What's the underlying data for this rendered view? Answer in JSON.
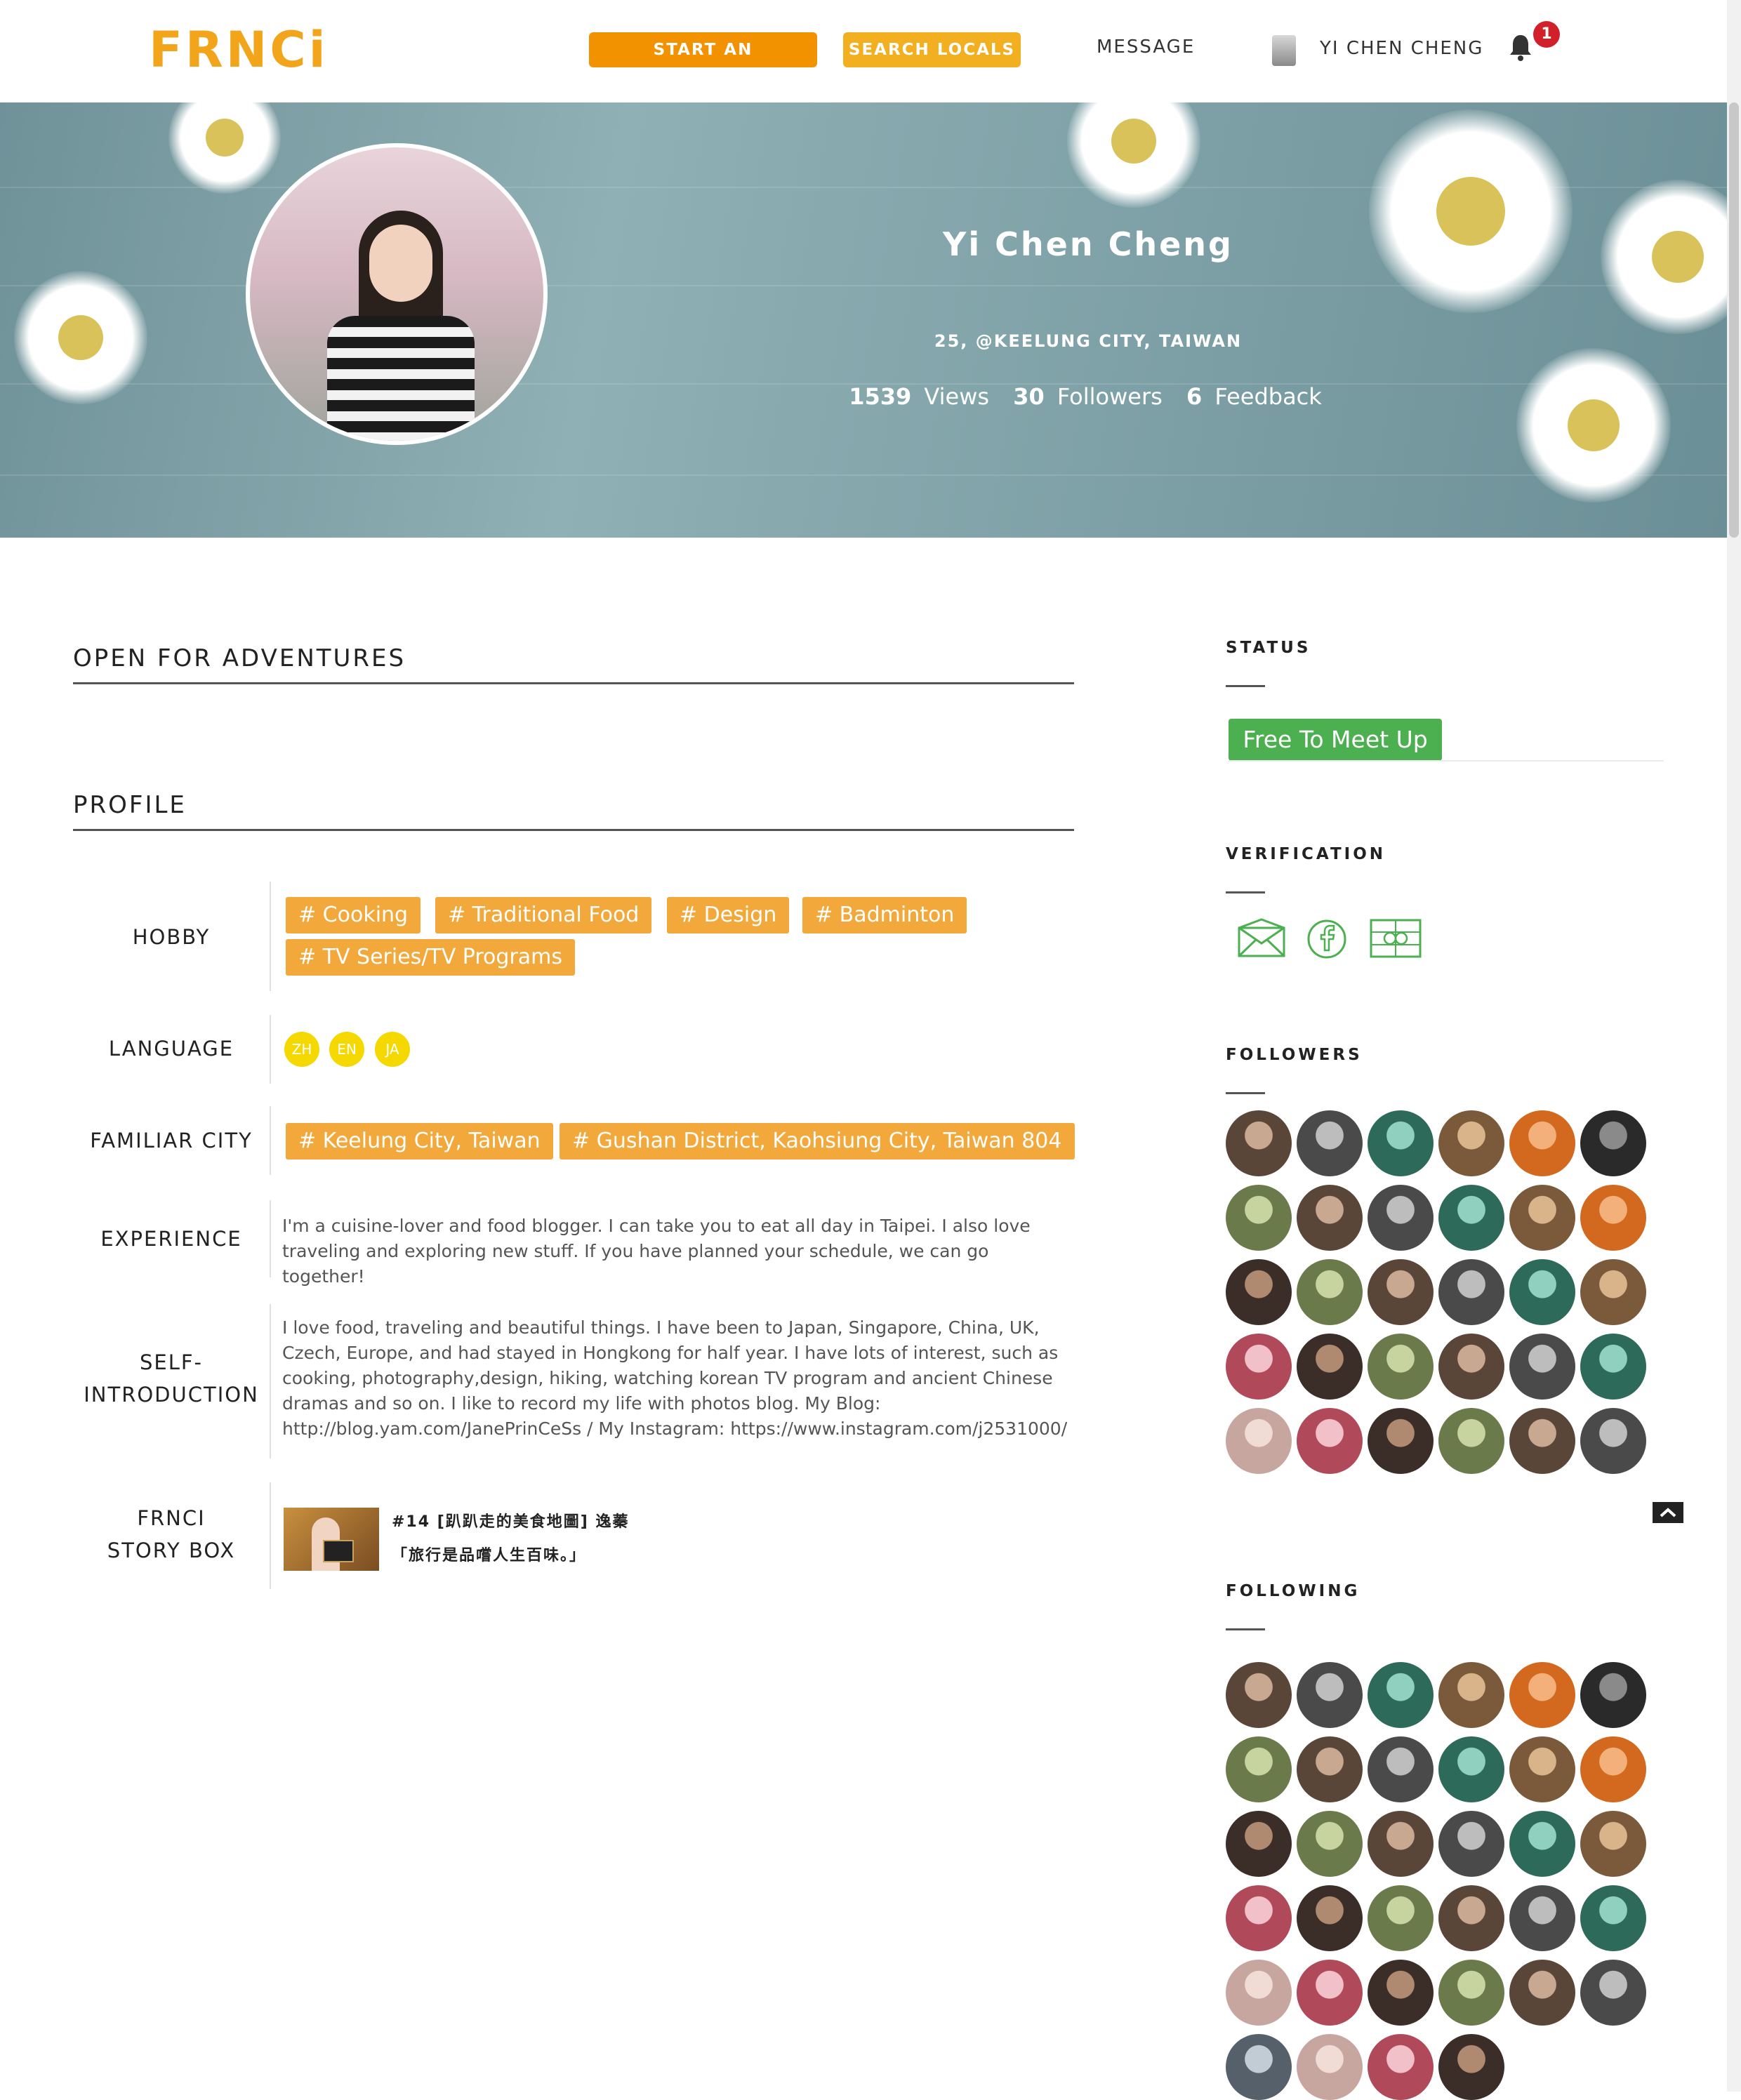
{
  "nav": {
    "logo": "FRNCi",
    "start_label": "START AN ADVENTURE",
    "search_label": "SEARCH LOCALS",
    "message_label": "MESSAGE",
    "user_name": "YI CHEN CHENG",
    "notification_count": "1"
  },
  "hero": {
    "name": "Yi Chen Cheng",
    "location": "25, @KEELUNG CITY, TAIWAN",
    "views_count": "1539",
    "views_label": "Views",
    "followers_count": "30",
    "followers_label": "Followers",
    "feedback_count": "6",
    "feedback_label": "Feedback"
  },
  "main": {
    "adventures_heading": "OPEN FOR ADVENTURES",
    "profile_heading": "PROFILE",
    "hobby_label": "HOBBY",
    "hobbies": [
      "#   Cooking",
      "#   Traditional Food",
      "#   Design",
      "#   Badminton",
      "#   TV Series/TV Programs"
    ],
    "language_label": "LANGUAGE",
    "languages": [
      "ZH",
      "EN",
      "JA"
    ],
    "city_label": "FAMILIAR CITY",
    "cities": [
      "#   Keelung City, Taiwan",
      "#   Gushan District, Kaohsiung City, Taiwan 804"
    ],
    "experience_label": "EXPERIENCE",
    "experience_text": "I'm a cuisine-lover and food blogger. I can take you to eat all day in Taipei. I also love traveling and exploring new stuff. If you have planned your schedule, we can go together!",
    "intro_label_1": "SELF-",
    "intro_label_2": "INTRODUCTION",
    "intro_text": "I love food, traveling and beautiful things. I have been to Japan, Singapore, China, UK, Czech, Europe, and had stayed in Hongkong for half year. I have lots of interest, such as cooking, photography,design, hiking, watching korean TV program and ancient Chinese dramas and so on. I like to record my life with photos blog. My Blog: http://blog.yam.com/JanePrinCeSs / My Instagram: https://www.instagram.com/j2531000/",
    "story_label_1": "FRNCI",
    "story_label_2": "STORY BOX",
    "story_title_1": "#14 [趴趴走的美食地圖] 逸蓁",
    "story_title_2": "「旅行是品嚐人生百味。」"
  },
  "sidebar": {
    "status_heading": "STATUS",
    "status_value": "Free To Meet Up",
    "verification_heading": "VERIFICATION",
    "verification_icons": [
      "email-icon",
      "facebook-icon",
      "id-card-icon"
    ],
    "followers_heading": "FOLLOWERS",
    "following_heading": "FOLLOWING"
  },
  "colors": {
    "accent_orange": "#f29200",
    "tag_orange": "#f2a83a",
    "status_green": "#4caf50",
    "language_yellow": "#f5d800",
    "badge_red": "#d2202b"
  }
}
